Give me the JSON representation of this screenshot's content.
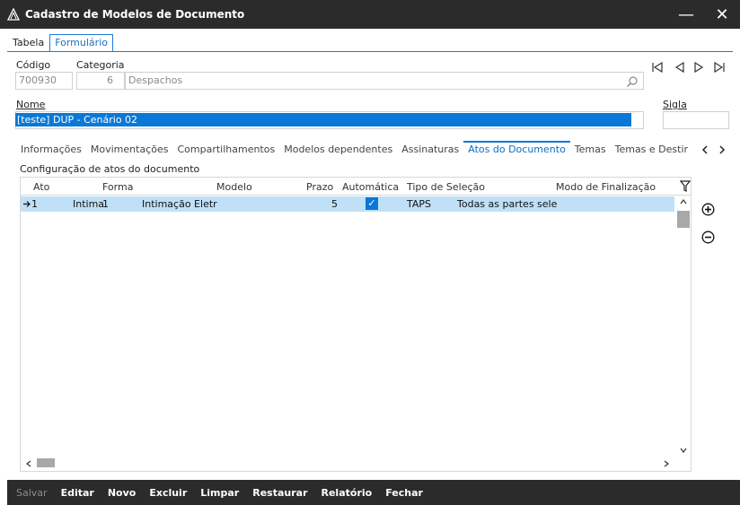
{
  "window": {
    "title": "Cadastro de Modelos de Documento",
    "minimize_glyph": "—",
    "close_glyph": "✕"
  },
  "top_tabs": [
    {
      "label": "Tabela",
      "active": false
    },
    {
      "label": "Formulário",
      "active": true
    }
  ],
  "form": {
    "codigo_label": "Código",
    "codigo_value": "700930",
    "categoria_label": "Categoria",
    "categoria_num": "6",
    "categoria_text": "Despachos",
    "nome_label": "Nome",
    "nome_value": "[teste] DUP - Cenário 02",
    "sigla_label": "Sigla",
    "sigla_value": ""
  },
  "record_nav": {
    "first": "⏮",
    "prev": "◁",
    "next": "▷",
    "last": "⏭"
  },
  "sub_tabs": [
    {
      "label": "Informações",
      "active": false
    },
    {
      "label": "Movimentações",
      "active": false
    },
    {
      "label": "Compartilhamentos",
      "active": false
    },
    {
      "label": "Modelos dependentes",
      "active": false
    },
    {
      "label": "Assinaturas",
      "active": false
    },
    {
      "label": "Atos do Documento",
      "active": true
    },
    {
      "label": "Temas",
      "active": false
    },
    {
      "label": "Temas e Destir",
      "active": false
    }
  ],
  "section_label": "Configuração de atos do documento",
  "table": {
    "columns": [
      "Ato",
      "Forma",
      "Modelo",
      "Prazo",
      "Automática",
      "Tipo de Seleção",
      "Modo de Finalização"
    ],
    "rows": [
      {
        "ato": "1",
        "forma_a": "Intima",
        "forma_b": "1",
        "modelo": "Intimação Eletr",
        "prazo": "5",
        "automatica": true,
        "tipo_a": "TAPS",
        "tipo_b": "Todas as partes sele",
        "modo": ""
      }
    ]
  },
  "bottom_buttons": [
    {
      "label": "Salvar",
      "enabled": false
    },
    {
      "label": "Editar",
      "enabled": true
    },
    {
      "label": "Novo",
      "enabled": true
    },
    {
      "label": "Excluir",
      "enabled": true
    },
    {
      "label": "Limpar",
      "enabled": true
    },
    {
      "label": "Restaurar",
      "enabled": true
    },
    {
      "label": "Relatório",
      "enabled": true
    },
    {
      "label": "Fechar",
      "enabled": true
    }
  ],
  "colors": {
    "titlebar": "#2b2b2b",
    "accent": "#0a78d7",
    "row_selected": "#bfe0f7"
  }
}
